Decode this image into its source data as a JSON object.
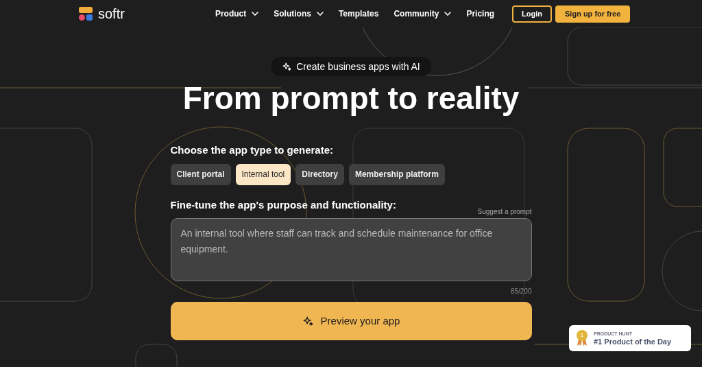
{
  "nav": {
    "logo": "softr",
    "items": [
      {
        "label": "Product",
        "dropdown": true
      },
      {
        "label": "Solutions",
        "dropdown": true
      },
      {
        "label": "Templates",
        "dropdown": false
      },
      {
        "label": "Community",
        "dropdown": true
      },
      {
        "label": "Pricing",
        "dropdown": false
      }
    ],
    "login": "Login",
    "signup": "Sign up for free"
  },
  "hero": {
    "pill": "Create business apps with AI",
    "title": "From prompt to reality"
  },
  "form": {
    "type_label": "Choose the app type to generate:",
    "types": [
      {
        "label": "Client portal",
        "selected": false
      },
      {
        "label": "Internal tool",
        "selected": true
      },
      {
        "label": "Directory",
        "selected": false
      },
      {
        "label": "Membership platform",
        "selected": false
      }
    ],
    "prompt_label": "Fine-tune the app's purpose and functionality:",
    "suggest": "Suggest a prompt",
    "prompt_value": "An internal tool where staff can track and schedule maintenance for office equipment.",
    "counter": "85/200",
    "submit": "Preview your app"
  },
  "badge": {
    "medal": "1",
    "kicker": "PRODUCT HUNT",
    "title": "#1 Product of the Day"
  }
}
